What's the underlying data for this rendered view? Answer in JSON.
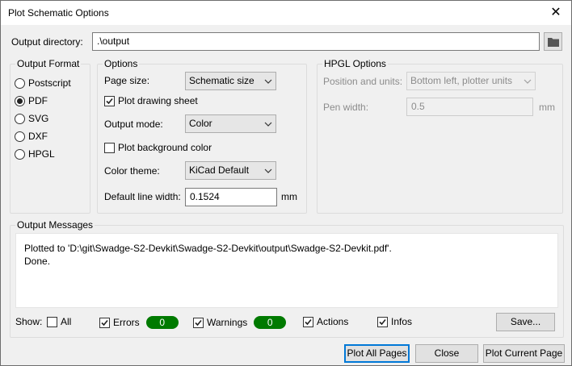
{
  "window": {
    "title": "Plot Schematic Options"
  },
  "output_directory": {
    "label": "Output directory:",
    "value": ".\\output"
  },
  "output_format": {
    "title": "Output Format",
    "options": [
      "Postscript",
      "PDF",
      "SVG",
      "DXF",
      "HPGL"
    ],
    "selected": "PDF"
  },
  "options": {
    "title": "Options",
    "page_size_label": "Page size:",
    "page_size_value": "Schematic size",
    "plot_drawing_sheet_label": "Plot drawing sheet",
    "plot_drawing_sheet_checked": true,
    "output_mode_label": "Output mode:",
    "output_mode_value": "Color",
    "plot_background_label": "Plot background color",
    "plot_background_checked": false,
    "color_theme_label": "Color theme:",
    "color_theme_value": "KiCad Default",
    "line_width_label": "Default line width:",
    "line_width_value": "0.1524",
    "line_width_unit": "mm"
  },
  "hpgl": {
    "title": "HPGL Options",
    "position_label": "Position and units:",
    "position_value": "Bottom left, plotter units",
    "pen_width_label": "Pen width:",
    "pen_width_value": "0.5",
    "pen_width_unit": "mm"
  },
  "messages": {
    "title": "Output Messages",
    "line1": "Plotted to 'D:\\git\\Swadge-S2-Devkit\\Swadge-S2-Devkit\\output\\Swadge-S2-Devkit.pdf'.",
    "line2": "Done."
  },
  "filters": {
    "show_label": "Show:",
    "all_label": "All",
    "errors_label": "Errors",
    "errors_count": "0",
    "warnings_label": "Warnings",
    "warnings_count": "0",
    "actions_label": "Actions",
    "infos_label": "Infos",
    "save_label": "Save..."
  },
  "buttons": {
    "plot_all": "Plot All Pages",
    "close": "Close",
    "plot_current": "Plot Current Page"
  },
  "colors": {
    "badge": "#007a00",
    "focus": "#0078d7"
  }
}
